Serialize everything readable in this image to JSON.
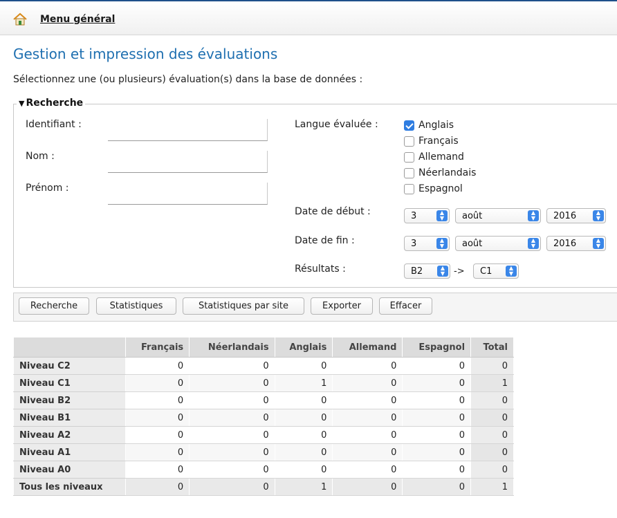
{
  "menu": {
    "label": "Menu général",
    "icon": "home-icon"
  },
  "page": {
    "title": "Gestion et impression des évaluations",
    "intro": "Sélectionnez une (ou plusieurs) évaluation(s) dans la base de données :"
  },
  "search": {
    "legend": "Recherche",
    "fields": {
      "identifiant_label": "Identifiant :",
      "identifiant_value": "",
      "nom_label": "Nom :",
      "nom_value": "",
      "prenom_label": "Prénom :",
      "prenom_value": ""
    },
    "langue_label": "Langue évaluée :",
    "languages": [
      {
        "label": "Anglais",
        "checked": true
      },
      {
        "label": "Français",
        "checked": false
      },
      {
        "label": "Allemand",
        "checked": false
      },
      {
        "label": "Néerlandais",
        "checked": false
      },
      {
        "label": "Espagnol",
        "checked": false
      }
    ],
    "date_debut_label": "Date de début :",
    "date_debut": {
      "day": "3",
      "month": "août",
      "year": "2016"
    },
    "date_fin_label": "Date de fin :",
    "date_fin": {
      "day": "3",
      "month": "août",
      "year": "2016"
    },
    "resultats_label": "Résultats :",
    "resultats_from": "B2",
    "resultats_arrow": "->",
    "resultats_to": "C1"
  },
  "buttons": {
    "recherche": "Recherche",
    "statistiques": "Statistiques",
    "statistiques_site": "Statistiques par site",
    "exporter": "Exporter",
    "effacer": "Effacer"
  },
  "table": {
    "headers": [
      "",
      "Français",
      "Néerlandais",
      "Anglais",
      "Allemand",
      "Espagnol",
      "Total"
    ],
    "rows": [
      {
        "label": "Niveau C2",
        "values": [
          "0",
          "0",
          "0",
          "0",
          "0",
          "0"
        ]
      },
      {
        "label": "Niveau C1",
        "values": [
          "0",
          "0",
          "1",
          "0",
          "0",
          "1"
        ]
      },
      {
        "label": "Niveau B2",
        "values": [
          "0",
          "0",
          "0",
          "0",
          "0",
          "0"
        ]
      },
      {
        "label": "Niveau B1",
        "values": [
          "0",
          "0",
          "0",
          "0",
          "0",
          "0"
        ]
      },
      {
        "label": "Niveau A2",
        "values": [
          "0",
          "0",
          "0",
          "0",
          "0",
          "0"
        ]
      },
      {
        "label": "Niveau A1",
        "values": [
          "0",
          "0",
          "0",
          "0",
          "0",
          "0"
        ]
      },
      {
        "label": "Niveau A0",
        "values": [
          "0",
          "0",
          "0",
          "0",
          "0",
          "0"
        ]
      },
      {
        "label": "Tous les niveaux",
        "values": [
          "0",
          "0",
          "1",
          "0",
          "0",
          "1"
        ]
      }
    ]
  },
  "colors": {
    "title": "#1e6fb0",
    "accent": "#2f7de1",
    "topline": "#1e4f8a"
  }
}
